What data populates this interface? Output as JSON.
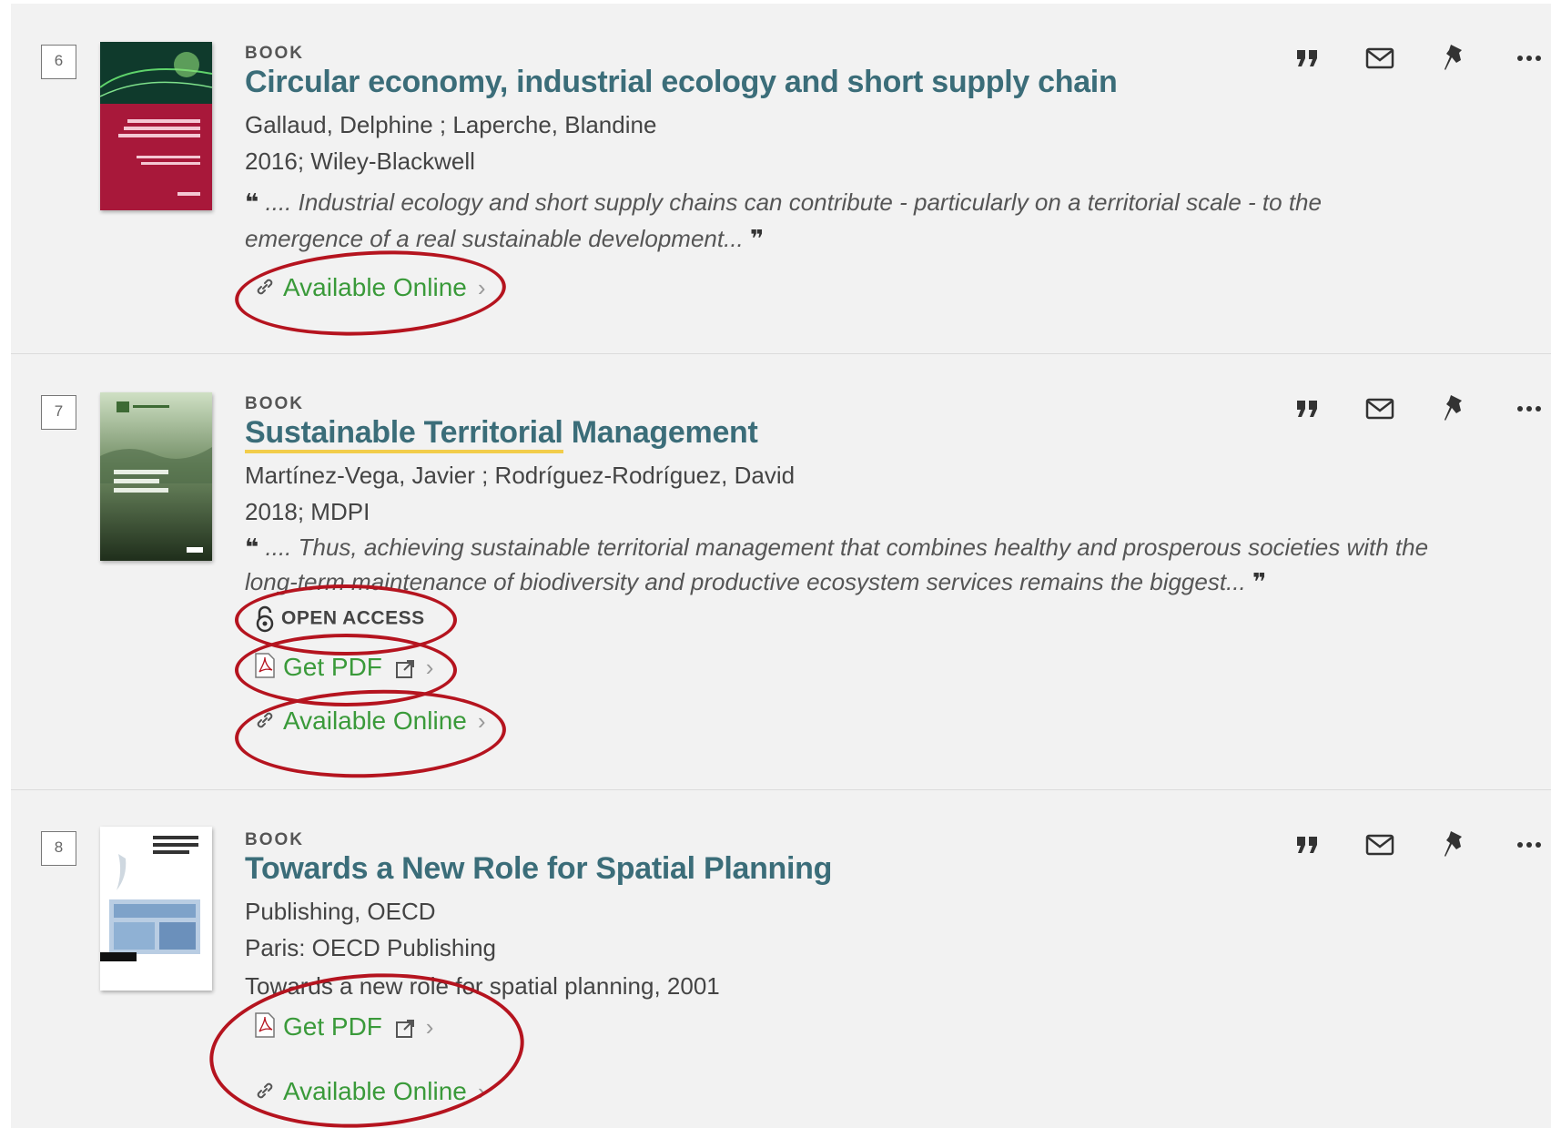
{
  "actions": {
    "cite_icon": "quote-icon",
    "email_icon": "envelope-icon",
    "pin_icon": "pushpin-icon",
    "more_icon": "more-horizontal-icon"
  },
  "colors": {
    "title": "#3b6d79",
    "link_green": "#3a9a3a",
    "annotation_red": "#b5141f",
    "highlight": "#f2cd4b"
  },
  "results": [
    {
      "number": "6",
      "type": "BOOK",
      "title": "Circular economy, industrial ecology and short supply chain",
      "authors": "Gallaud, Delphine ; Laperche, Blandine",
      "publication": "2016; Wiley-Blackwell",
      "snippet": ".... Industrial ecology and short supply chains can contribute - particularly on a territorial scale - to the emergence of a real sustainable development...",
      "available_online": "Available Online"
    },
    {
      "number": "7",
      "type": "BOOK",
      "title_highlight": "Sustainable Territorial",
      "title_rest": " Management",
      "authors": "Martínez-Vega, Javier ; Rodríguez-Rodríguez, David",
      "publication": "2018; MDPI",
      "snippet": ".... Thus, achieving sustainable territorial management that combines healthy and prosperous societies with the long-term maintenance of biodiversity and productive ecosystem services remains the biggest...",
      "open_access": "OPEN ACCESS",
      "get_pdf": "Get PDF",
      "available_online": "Available Online"
    },
    {
      "number": "8",
      "type": "BOOK",
      "title": "Towards a New Role for Spatial Planning",
      "authors": "Publishing, OECD",
      "publication": "Paris: OECD Publishing",
      "series": "Towards a new role for spatial planning, 2001",
      "get_pdf": "Get PDF",
      "available_online": "Available Online"
    }
  ]
}
